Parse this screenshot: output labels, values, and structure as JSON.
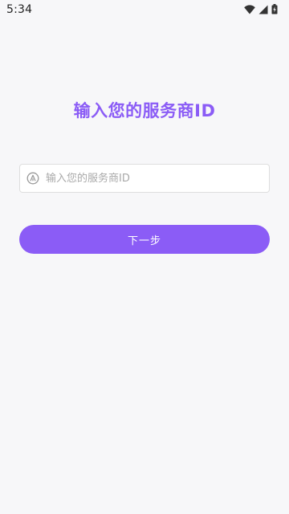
{
  "status_bar": {
    "time": "5:34",
    "icons": [
      "wifi-icon",
      "signal-icon",
      "battery-icon"
    ]
  },
  "main": {
    "title": "输入您的服务商ID",
    "input": {
      "icon": "letter-a-circle-icon",
      "placeholder": "输入您的服务商ID",
      "value": ""
    },
    "next_button_label": "下一步"
  },
  "colors": {
    "accent": "#8b5cf6",
    "background": "#f7f7f9",
    "input_border": "#dedede"
  }
}
